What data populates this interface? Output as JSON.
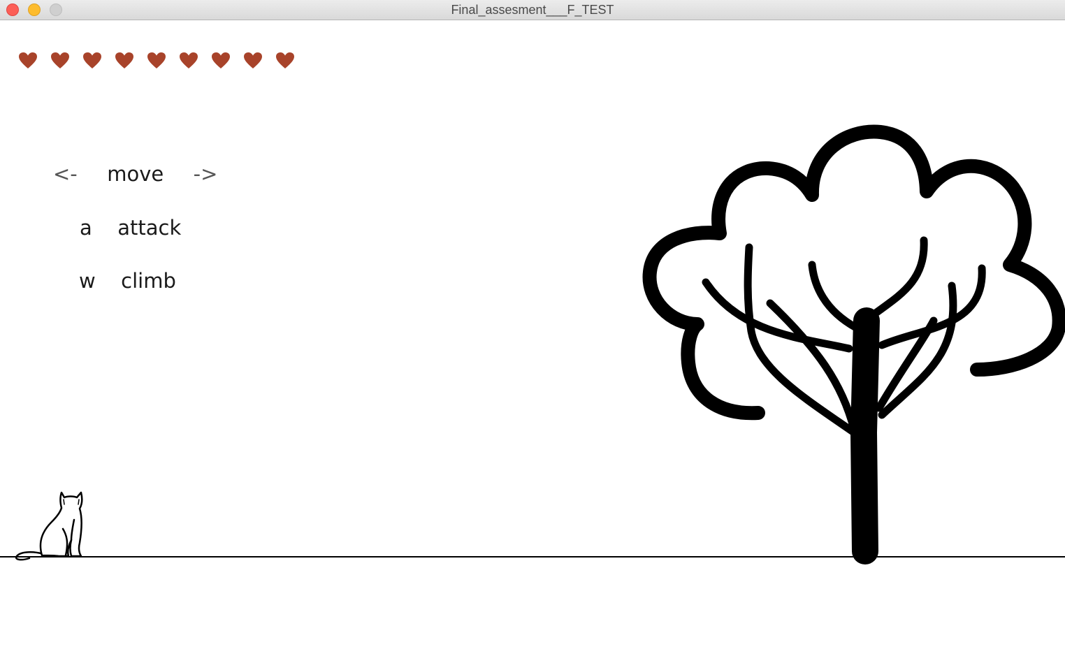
{
  "window": {
    "title": "Final_assesment___F_TEST"
  },
  "hud": {
    "lives": 9,
    "heart_color": "#a8432a",
    "heart_icon": "heart-icon"
  },
  "controls": {
    "move": {
      "left_key": "<-",
      "label": "move",
      "right_key": "->"
    },
    "attack": {
      "key": "a",
      "label": "attack"
    },
    "climb": {
      "key": "w",
      "label": "climb"
    }
  },
  "scene": {
    "player": "cat",
    "objects": [
      "tree"
    ],
    "ground_color": "#000000"
  }
}
